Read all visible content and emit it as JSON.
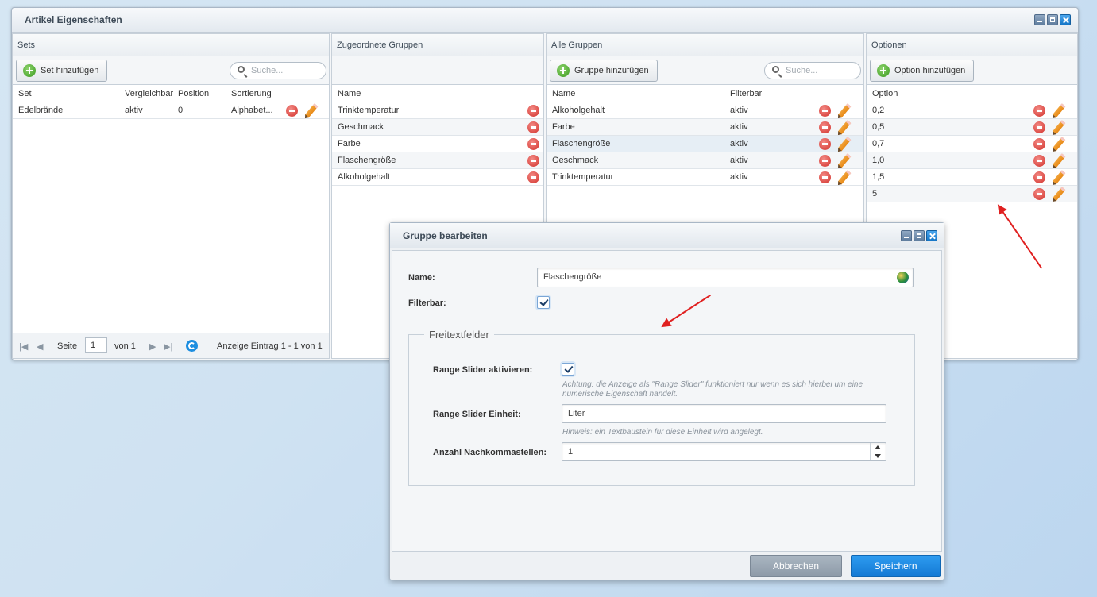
{
  "window": {
    "title": "Artikel Eigenschaften"
  },
  "sets": {
    "header": "Sets",
    "add_label": "Set hinzufügen",
    "search_placeholder": "Suche...",
    "columns": [
      "Set",
      "Vergleichbar",
      "Position",
      "Sortierung"
    ],
    "rows": [
      {
        "set": "Edelbrände",
        "vergleichbar": "aktiv",
        "position": "0",
        "sortierung": "Alphabet..."
      }
    ],
    "pager": {
      "page_label": "Seite",
      "page": "1",
      "of_label": "von 1",
      "info": "Anzeige Eintrag 1 - 1 von 1"
    }
  },
  "assigned": {
    "header": "Zugeordnete Gruppen",
    "column": "Name",
    "rows": [
      "Trinktemperatur",
      "Geschmack",
      "Farbe",
      "Flaschengröße",
      "Alkoholgehalt"
    ]
  },
  "all_groups": {
    "header": "Alle Gruppen",
    "add_label": "Gruppe hinzufügen",
    "search_placeholder": "Suche...",
    "columns": [
      "Name",
      "Filterbar"
    ],
    "rows": [
      {
        "name": "Alkoholgehalt",
        "filterbar": "aktiv"
      },
      {
        "name": "Farbe",
        "filterbar": "aktiv"
      },
      {
        "name": "Flaschengröße",
        "filterbar": "aktiv"
      },
      {
        "name": "Geschmack",
        "filterbar": "aktiv"
      },
      {
        "name": "Trinktemperatur",
        "filterbar": "aktiv"
      }
    ]
  },
  "options": {
    "header": "Optionen",
    "add_label": "Option hinzufügen",
    "column": "Option",
    "rows": [
      "0,2",
      "0,5",
      "0,7",
      "1,0",
      "1,5",
      "5"
    ]
  },
  "dialog": {
    "title": "Gruppe bearbeiten",
    "name_label": "Name:",
    "name_value": "Flaschengröße",
    "filterbar_label": "Filterbar:",
    "filterbar_checked": true,
    "fieldset_legend": "Freitextfelder",
    "range_slider_label": "Range Slider aktivieren:",
    "range_slider_checked": true,
    "range_slider_hint": "Achtung: die Anzeige als \"Range Slider\" funktioniert nur wenn es sich hierbei um eine numerische Eigenschaft handelt.",
    "unit_label": "Range Slider Einheit:",
    "unit_value": "Liter",
    "unit_hint": "Hinweis: ein Textbaustein für diese Einheit wird angelegt.",
    "decimals_label": "Anzahl Nachkommastellen:",
    "decimals_value": "1",
    "cancel_label": "Abbrechen",
    "save_label": "Speichern"
  },
  "colors": {
    "accent": "#1a86e0",
    "annotation_arrow": "#e02020"
  }
}
